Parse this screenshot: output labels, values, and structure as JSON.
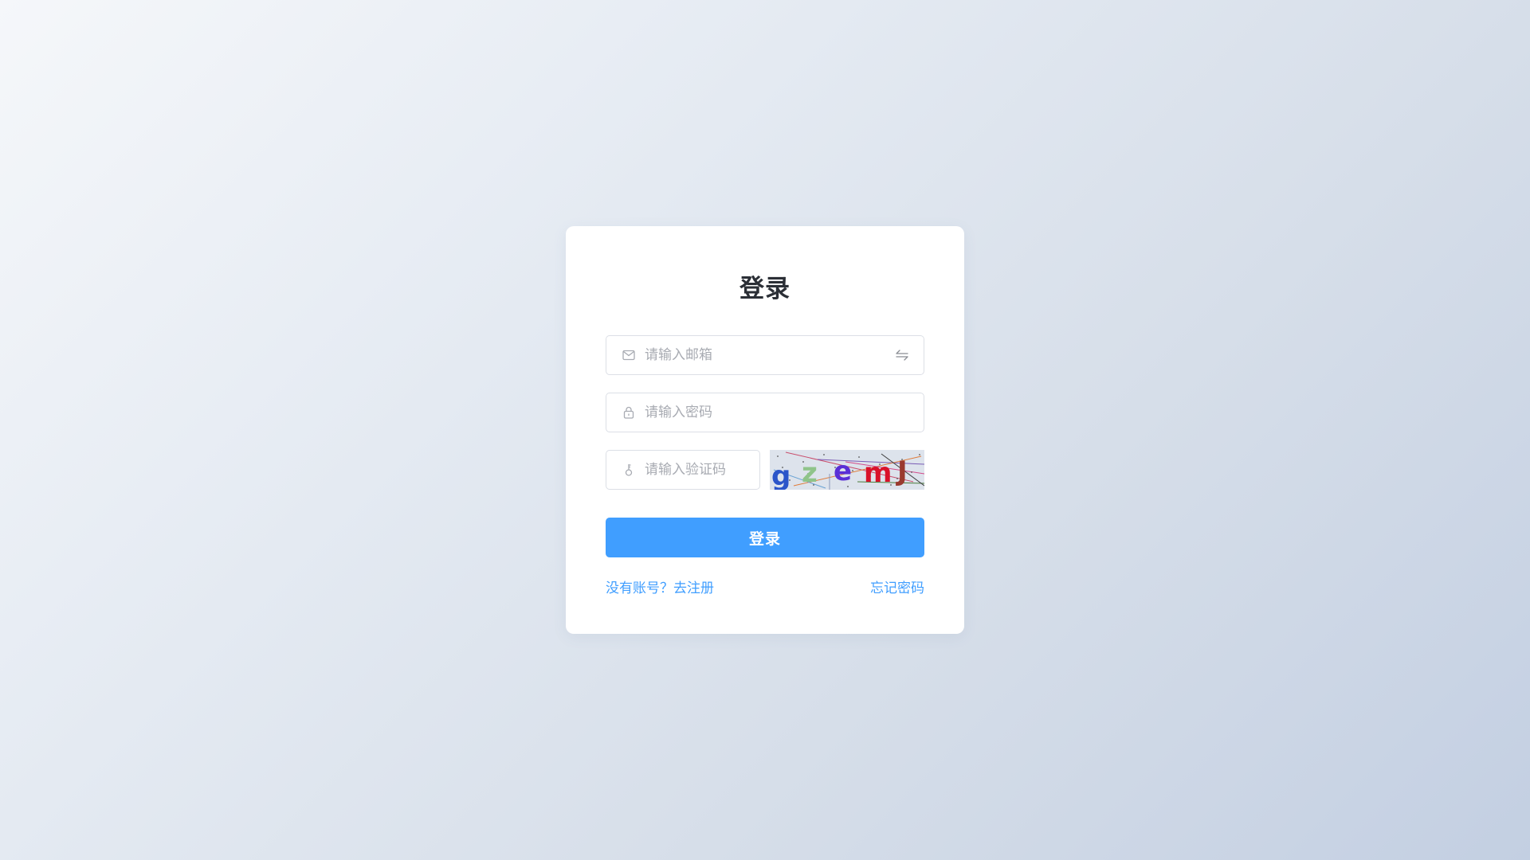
{
  "login": {
    "title": "登录",
    "email_placeholder": "请输入邮箱",
    "password_placeholder": "请输入密码",
    "captcha_placeholder": "请输入验证码",
    "captcha_text": "gzemJ",
    "submit_label": "登录",
    "register_link": "没有账号？去注册",
    "forgot_link": "忘记密码"
  },
  "icons": {
    "email": "mail-icon",
    "password": "lock-icon",
    "captcha": "key-icon",
    "switch": "switch-icon"
  },
  "colors": {
    "accent": "#409eff",
    "title": "#2b2f36",
    "placeholder": "#a8abb2",
    "border": "#dcdfe6"
  }
}
